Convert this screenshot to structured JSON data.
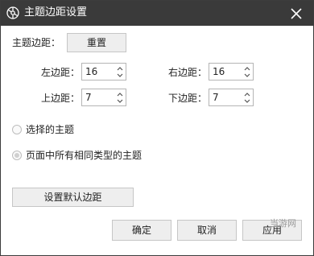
{
  "window": {
    "title": "主题边距设置",
    "close_label": "关闭"
  },
  "margins": {
    "label": "主题边距：",
    "reset_button": "重置",
    "left": {
      "label": "左边距：",
      "value": "16"
    },
    "right": {
      "label": "右边距：",
      "value": "16"
    },
    "top": {
      "label": "上边距：",
      "value": "7"
    },
    "bottom": {
      "label": "下边距：",
      "value": "7"
    }
  },
  "scope_options": [
    {
      "label": "选择的主题",
      "selected": false
    },
    {
      "label": "页面中所有相同类型的主题",
      "selected": true
    }
  ],
  "set_default_button": "设置默认边距",
  "footer": {
    "ok": "确定",
    "cancel": "取消",
    "apply": "应用"
  },
  "watermark": {
    "text": "当游网"
  },
  "colors": {
    "titlebar": "#3a3a3a",
    "button_bg": "#eeeeee",
    "border": "#c6c6c6"
  },
  "icons": {
    "app": "settings-gear-icon",
    "close": "close-icon",
    "spin_up": "chevron-up-icon",
    "spin_down": "chevron-down-icon"
  }
}
